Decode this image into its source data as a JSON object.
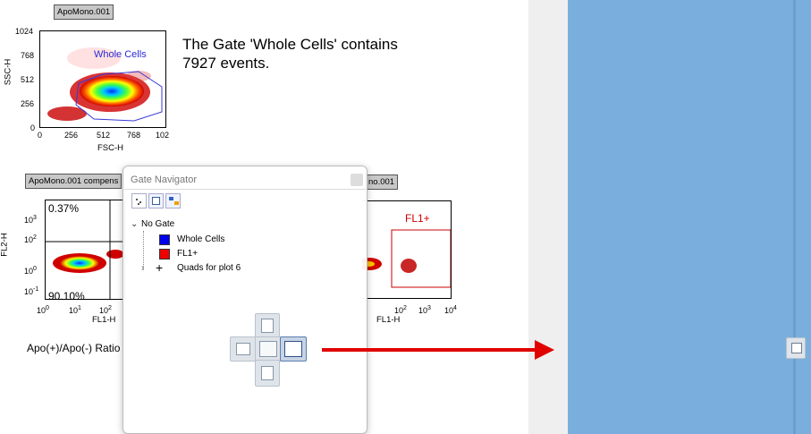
{
  "plot1": {
    "tag": "ApoMono.001",
    "y_ticks": [
      "1024",
      "768",
      "512",
      "256",
      "0"
    ],
    "x_ticks": [
      "0",
      "256",
      "512",
      "768",
      "102"
    ],
    "y_label": "SSC-H",
    "x_label": "FSC-H",
    "gate_label": "Whole Cells"
  },
  "stats_text": {
    "line1": "The Gate 'Whole Cells' contains",
    "line2": "7927 events."
  },
  "plot2": {
    "tag": "ApoMono.001 compens",
    "y_label": "FL2-H",
    "x_label": "FL1-H",
    "q_upper_left": "0.37%",
    "q_lower_left": "90.10%"
  },
  "plot3": {
    "tag": "no.001",
    "x_label": "FL1-H",
    "gate_label": "FL1+"
  },
  "ratio_label": "Apo(+)/Apo(-) Ratio",
  "gate_navigator": {
    "title": "Gate Navigator",
    "tree": {
      "root": "No Gate",
      "items": [
        {
          "label": "Whole Cells",
          "color": "#0000ee"
        },
        {
          "label": "FL1+",
          "color": "#ee0000"
        },
        {
          "label": "Quads for plot 6"
        }
      ]
    }
  },
  "colors": {
    "arrow": "#e00000",
    "blue_pane": "#7aafdd",
    "gate_whole_cells": "#2a2ad8",
    "gate_fl1": "#cc0000"
  }
}
